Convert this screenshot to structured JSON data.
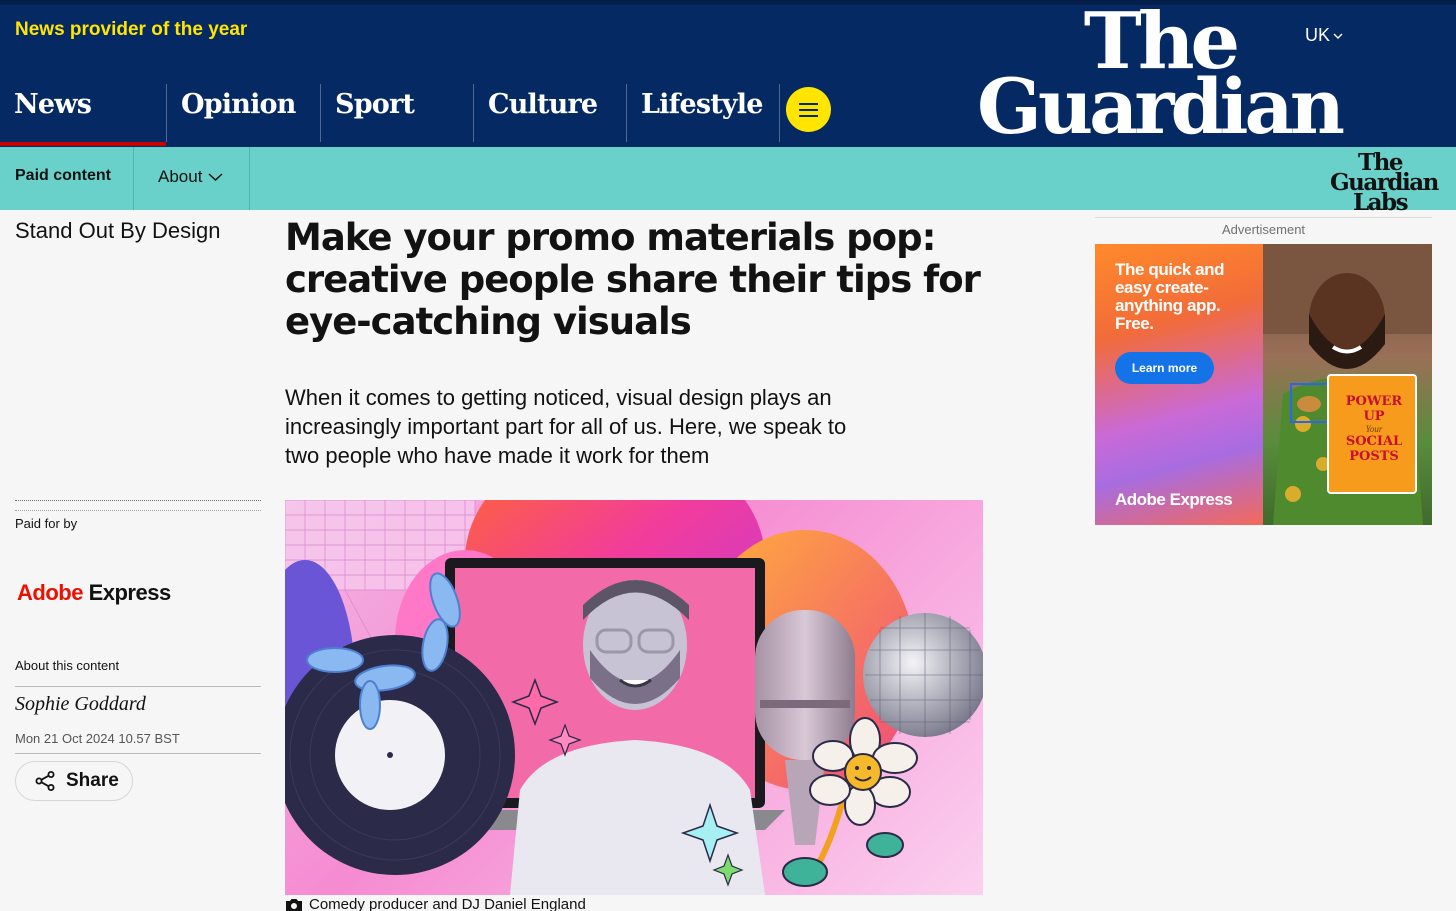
{
  "header": {
    "tagline": "News provider of the year",
    "edition": "UK",
    "logo_line1": "The",
    "logo_line2": "Guardian",
    "colors": {
      "navy": "#052962",
      "yellow": "#ffe500",
      "red": "#c70000"
    },
    "pillars": [
      {
        "label": "News",
        "active": true
      },
      {
        "label": "Opinion",
        "active": false
      },
      {
        "label": "Sport",
        "active": false
      },
      {
        "label": "Culture",
        "active": false
      },
      {
        "label": "Lifestyle",
        "active": false
      }
    ],
    "menu_icon": "hamburger-icon"
  },
  "labs_bar": {
    "paid_content": "Paid content",
    "about": "About",
    "logo_line1": "The",
    "logo_line2": "Guardian",
    "logo_line3": "Labs",
    "color": "#69d1ca"
  },
  "sidebar": {
    "series": "Stand Out By Design",
    "paid_for_by": "Paid for by",
    "sponsor_part1": "Adobe",
    "sponsor_part2": "Express",
    "about_content": "About this content",
    "author": "Sophie Goddard",
    "date": "Mon 21 Oct 2024 10.57 BST",
    "share": "Share"
  },
  "article": {
    "headline": "Make your promo materials pop: creative people share their tips for eye-catching visuals",
    "standfirst": "When it comes to getting noticed, visual design plays an increasingly important part for all of us. Here, we speak to two people who have made it work for them",
    "caption": "Comedy producer and DJ Daniel England"
  },
  "ad": {
    "label": "Advertisement",
    "copy": "The quick and easy create-anything app. Free.",
    "cta": "Learn more",
    "brand": "Adobe Express",
    "card_line1": "POWER UP",
    "card_line2": "Your",
    "card_line3": "SOCIAL POSTS"
  }
}
